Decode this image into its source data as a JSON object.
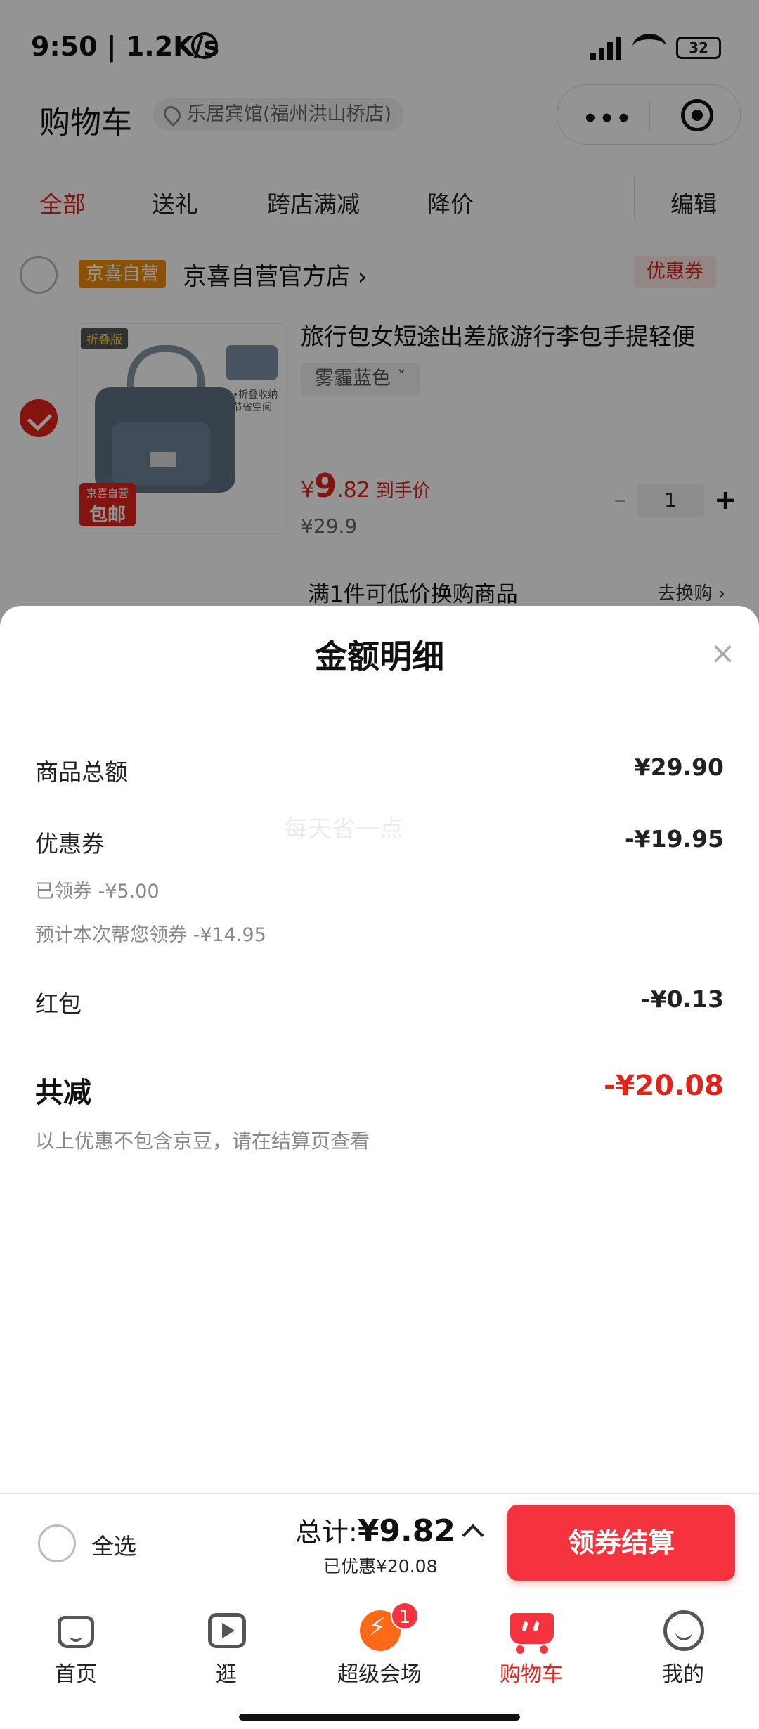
{
  "status_bar": {
    "time": "9:50 | 1.2K/s",
    "battery": "32"
  },
  "header": {
    "title": "购物车",
    "location": "乐居宾馆(福州洪山桥店)",
    "capsule_more": "•••"
  },
  "tabs": [
    {
      "label": "全部",
      "active": true
    },
    {
      "label": "送礼"
    },
    {
      "label": "跨店满减"
    },
    {
      "label": "降价"
    },
    {
      "label": "编辑"
    }
  ],
  "store": {
    "badge": "京喜自营",
    "name": "京喜自营官方店 ›",
    "coupon": "优惠券",
    "product": {
      "title": "旅行包女短途出差旅游行李包手提轻便",
      "variant": "雾霾蓝色 ˇ",
      "img_badge": "折叠版",
      "img_text": "•折叠收纳\n节省空间",
      "free_ship_top": "京喜自营",
      "free_ship_bottom": "包邮",
      "price_yen": "¥",
      "price_int": "9",
      "price_dec": ".82",
      "price_note": "到手价",
      "original_price": "¥29.9",
      "quantity": "1",
      "minus": "–",
      "plus": "+"
    },
    "swap_text": "满1件可低价换购商品",
    "swap_link": "去换购 ›"
  },
  "sheet": {
    "title": "金额明细",
    "close": "×",
    "watermark": "每天省一点",
    "rows": [
      {
        "label": "商品总额",
        "value": "¥29.90"
      },
      {
        "label": "优惠券",
        "value": "-¥19.95"
      },
      {
        "label": "红包",
        "value": "-¥0.13"
      }
    ],
    "coupon_claimed": "已领券 -¥5.00",
    "coupon_estimated": "预计本次帮您领券 -¥14.95",
    "total_label": "共减",
    "total_value": "-¥20.08",
    "footnote": "以上优惠不包含京豆，请在结算页查看"
  },
  "checkout": {
    "select_all": "全选",
    "total_prefix": "总计:",
    "total_amount": "¥9.82",
    "saved": "已优惠¥20.08",
    "button": "领券结算"
  },
  "tabbar": [
    {
      "label": "首页",
      "icon": "home-icon"
    },
    {
      "label": "逛",
      "icon": "play-icon"
    },
    {
      "label": "超级会场",
      "icon": "fire-icon",
      "badge": "1"
    },
    {
      "label": "购物车",
      "icon": "cart-icon",
      "active": true
    },
    {
      "label": "我的",
      "icon": "smile-icon"
    }
  ],
  "colors": {
    "accent": "#e2231a",
    "button": "#f5333f"
  }
}
